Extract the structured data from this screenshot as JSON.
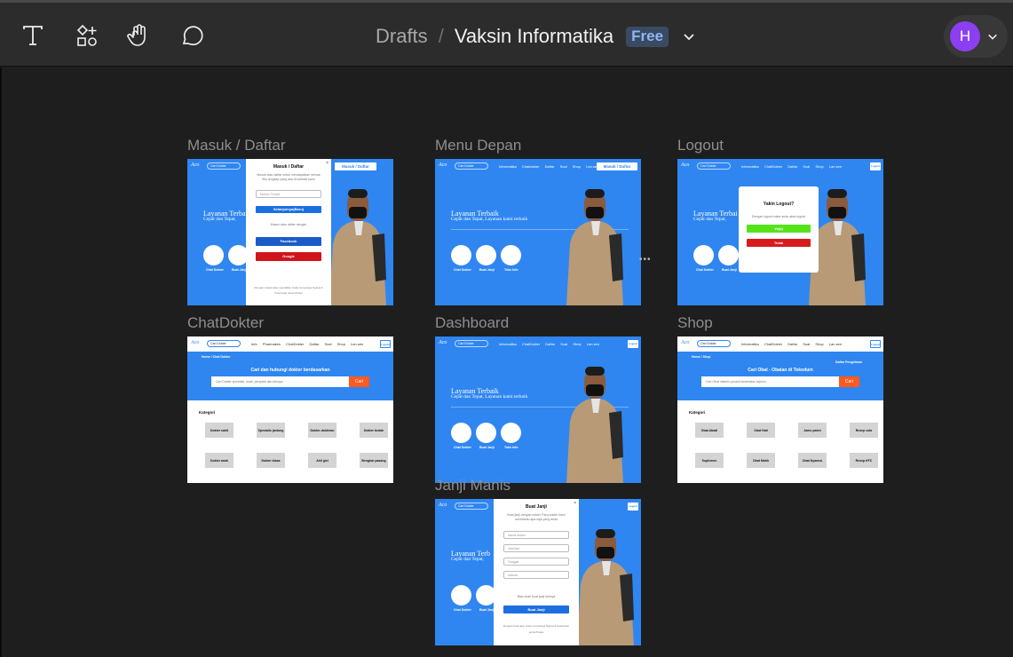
{
  "toolbar": {
    "tools": [
      {
        "name": "text-tool-icon"
      },
      {
        "name": "components-tool-icon"
      },
      {
        "name": "hand-tool-icon"
      },
      {
        "name": "comment-tool-icon"
      }
    ],
    "breadcrumb": {
      "drafts": "Drafts",
      "separator": "/",
      "file_name": "Vaksin Informatika",
      "plan_badge": "Free"
    },
    "user": {
      "initial": "H",
      "avatar_color": "#8b3ff0"
    }
  },
  "colors": {
    "canvas": "#1e1e1e",
    "frame_blue": "#2f86f0",
    "cta_orange": "#ff5a1f",
    "login_blue": "#1d6fe0",
    "google_red": "#d0141c",
    "yes_green": "#55e41a",
    "no_red": "#d71b1b"
  },
  "frames": {
    "masuk": {
      "label": "Masuk / Daftar",
      "cta": "Masuk / Daftar",
      "search": "Cari Dokter",
      "hero_title": "Layanan Terbaik",
      "hero_sub": "Cepat dan Tepat,",
      "c1": "Chat Dokter",
      "c2": "Buat Janji",
      "modal_title": "Masuk / Daftar",
      "modal_sub1": "Masuk atau daftar untuk mendapatkan semua",
      "modal_sub2": "fitur lengkap yang ada di website kami",
      "modal_phone": "Nomor Ponsel",
      "modal_continue": "Selanjutnya(Baru)",
      "modal_or": "Masuk atau daftar dengan",
      "modal_facebook": "Facebook",
      "modal_google": "Google",
      "modal_terms1": "Dengan masuk atau mendaftar, Anda menyetujui Syarat &",
      "modal_terms2": "Ketentuan serta Privasi"
    },
    "menu": {
      "label": "Menu Depan",
      "search": "Cari Dokter",
      "links": "Informatika Chatdokter Daftar Soal Shop Lan.sen",
      "cta": "Masuk / Daftar",
      "hero_title": "Layanan Terbaik",
      "hero_sub": "Cepat dan Tepat, Layanan kami terbaik",
      "c1": "Chat Dokter",
      "c2": "Buat Janji",
      "c3": "Toko Info"
    },
    "logout": {
      "label": "Logout",
      "search": "Cari Dokter",
      "links": "Informatika ChatDokter Daftar Soal Shop Lan.sen",
      "btn": "Logout",
      "hero_title": "Layanan Terbai",
      "hero_sub": "Cepat dan Tepat,",
      "c1": "Chat Dokter",
      "c2": "Buat Janji",
      "modal_title": "Yakin Logout?",
      "modal_sub": "Dengan logout maka anda akan logout",
      "yes": "Ya(a)",
      "no": "Tidak"
    },
    "chat": {
      "label": "ChatDokter",
      "search": "Cari Dokter",
      "links": "Info Pharmakes ChatDokter Daftar Soal Shop Lan.sen",
      "btn": "Logout",
      "breadcrumb": "Home / Chat Dokter",
      "title": "Cari dan hubungi dokter berdasarkan",
      "search_ph": "Cari Dokter spesialis, anak, penyakit dan lainnya",
      "cari": "Cari",
      "kategori": "Kategori",
      "cats": [
        "Dokter sakit",
        "Spesialis jantung",
        "Dokter-dokteran",
        "Dokter bedah",
        "Dokter anak",
        "Dokter biasa",
        "Ahli gizi",
        "Bengkar pasang"
      ]
    },
    "dashboard": {
      "label": "Dashboard",
      "search": "Cari Dokter",
      "links": "Informatika ChatDokter Daftar Soal Shop Lan.sen",
      "btn": "Logout",
      "hero_title": "Layanan Terbaik",
      "hero_sub": "Cepat dan Tepat, Layanan kami terbaik",
      "c1": "Chat Dokter",
      "c2": "Buat Janji",
      "c3": "Toko Info"
    },
    "shop": {
      "label": "Shop",
      "search": "Cari Dokter",
      "links": "Informatika ChatDokter Daftar Soal Shop Lan.sen",
      "btn": "Logout",
      "breadcrumb": "Home / Shop",
      "cart": "Daftar Pengiriman",
      "title": "Cari Obat - Obatan di Tokoduin",
      "search_ph": "Cari Obat vitamin produk kesehatan sejenis",
      "cari": "Cari",
      "kategori": "Kategori",
      "cats": [
        "Obat Abadi",
        "Obat Hati",
        "Jamu patch",
        "Resep cola",
        "Suplemen",
        "Obat Mahh",
        "Obat Nyamuk",
        "Resep KFC"
      ]
    },
    "janji": {
      "label": "Janji Manis",
      "search": "Cari Dokter",
      "btn": "Logout",
      "hero_title": "Layanan Terb",
      "hero_sub": "Cepat dan Tepat,",
      "c1": "Chat Dokter",
      "c2": "Buat Janji",
      "modal_title": "Buat Janji",
      "modal_sub1": "Buat janji dengan dokter Para dokter kami",
      "modal_sub2": "membantu apa saja yang anda",
      "fields": [
        "Nama dokter",
        "Jam/hari",
        "Tanggal",
        "Alamat"
      ],
      "note": "Bisa ubah buat janji lainnya",
      "submit": "Buat Janji",
      "terms1": "Dengan buat janji, anda menyetujui Syarat & Ketentuan",
      "terms2": "serta Privasi"
    }
  }
}
